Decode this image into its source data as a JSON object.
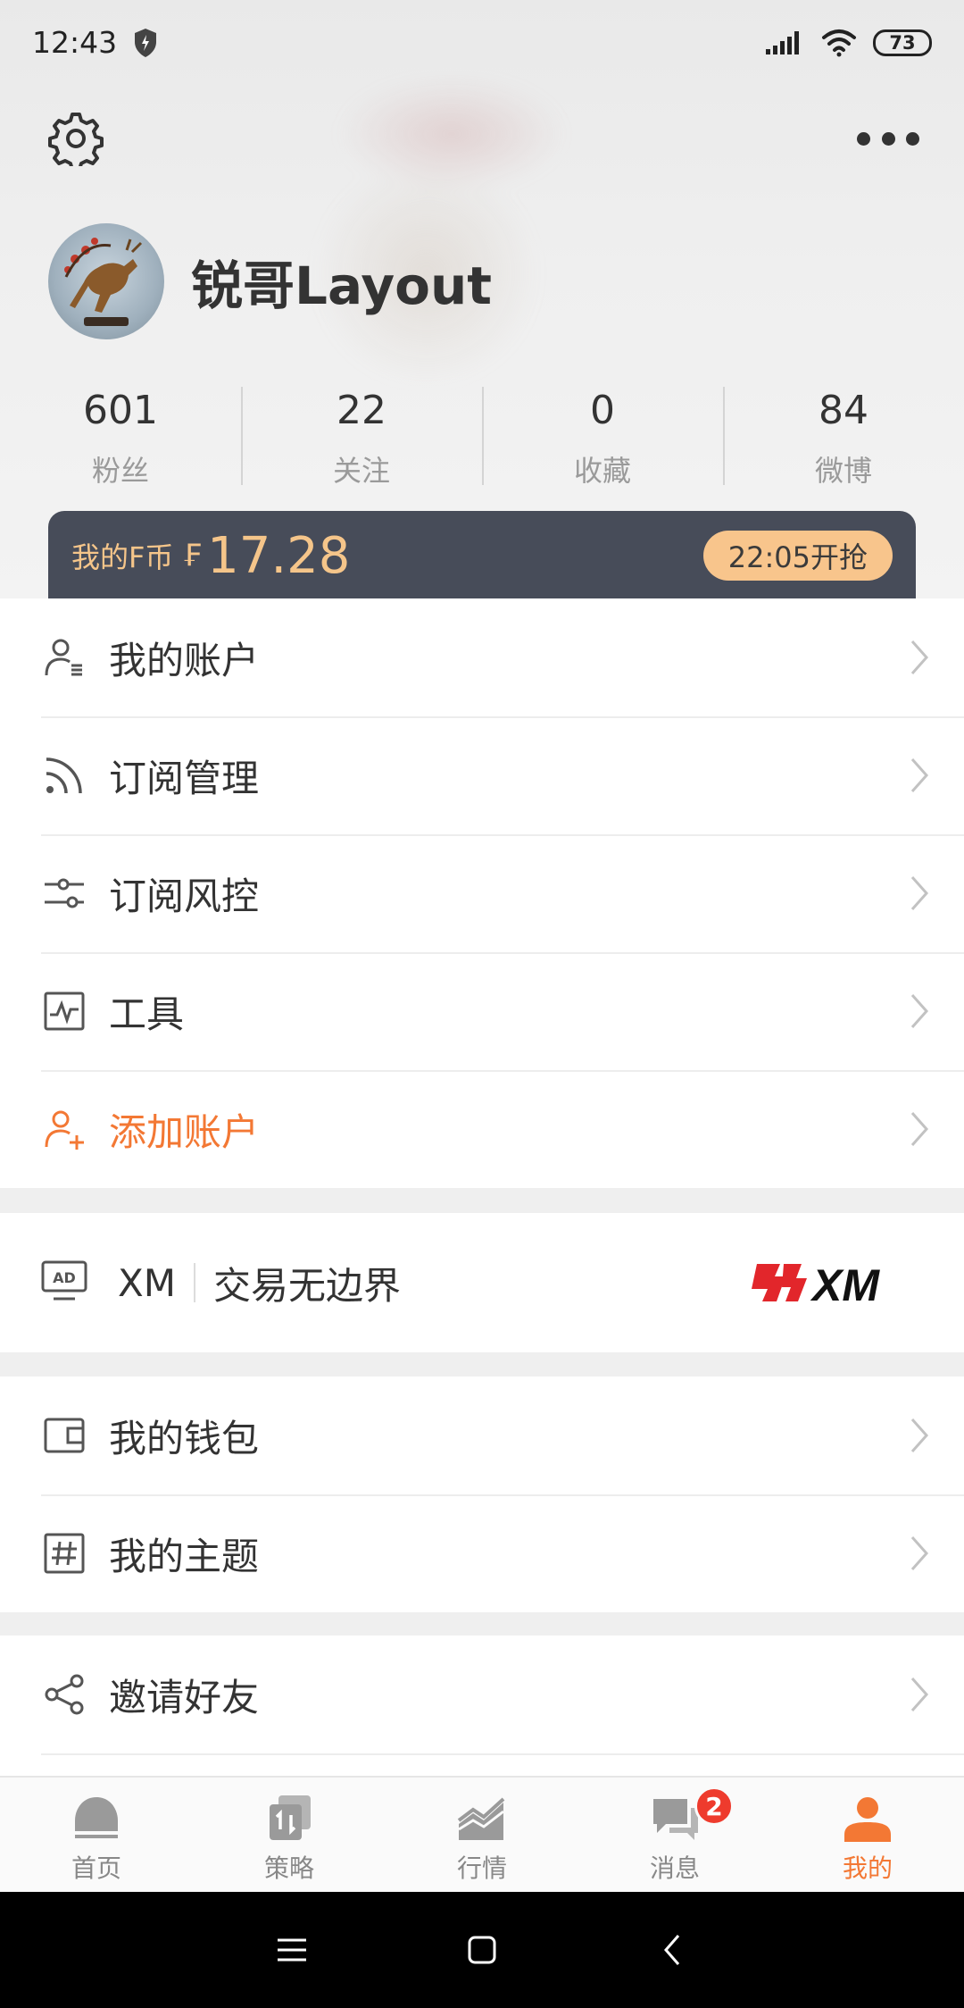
{
  "status": {
    "time": "12:43",
    "battery": "73"
  },
  "profile": {
    "username": "锐哥Layout"
  },
  "stats": [
    {
      "value": "601",
      "label": "粉丝"
    },
    {
      "value": "22",
      "label": "关注"
    },
    {
      "value": "0",
      "label": "收藏"
    },
    {
      "value": "84",
      "label": "微博"
    }
  ],
  "coins": {
    "label": "我的F币",
    "symbol": "₣",
    "value": "17.28",
    "button": "22:05开抢"
  },
  "menu1": [
    {
      "label": "我的账户",
      "icon": "account-icon"
    },
    {
      "label": "订阅管理",
      "icon": "rss-icon"
    },
    {
      "label": "订阅风控",
      "icon": "sliders-icon"
    },
    {
      "label": "工具",
      "icon": "chart-tool-icon"
    },
    {
      "label": "添加账户",
      "icon": "add-user-icon",
      "accent": true
    }
  ],
  "ad": {
    "name": "XM",
    "text": "交易无边界",
    "logo": "XM"
  },
  "menu2": [
    {
      "label": "我的钱包",
      "icon": "wallet-icon"
    },
    {
      "label": "我的主题",
      "icon": "hash-icon"
    }
  ],
  "menu3": [
    {
      "label": "邀请好友",
      "icon": "share-icon"
    }
  ],
  "tabs": [
    {
      "label": "首页",
      "icon": "home-icon"
    },
    {
      "label": "策略",
      "icon": "strategy-icon"
    },
    {
      "label": "行情",
      "icon": "market-icon"
    },
    {
      "label": "消息",
      "icon": "message-icon",
      "badge": "2"
    },
    {
      "label": "我的",
      "icon": "profile-icon",
      "active": true
    }
  ],
  "colors": {
    "accent": "#f37834",
    "coin_bar": "#474c59",
    "coin_text": "#f5c58a",
    "badge": "#ee3b2d"
  }
}
